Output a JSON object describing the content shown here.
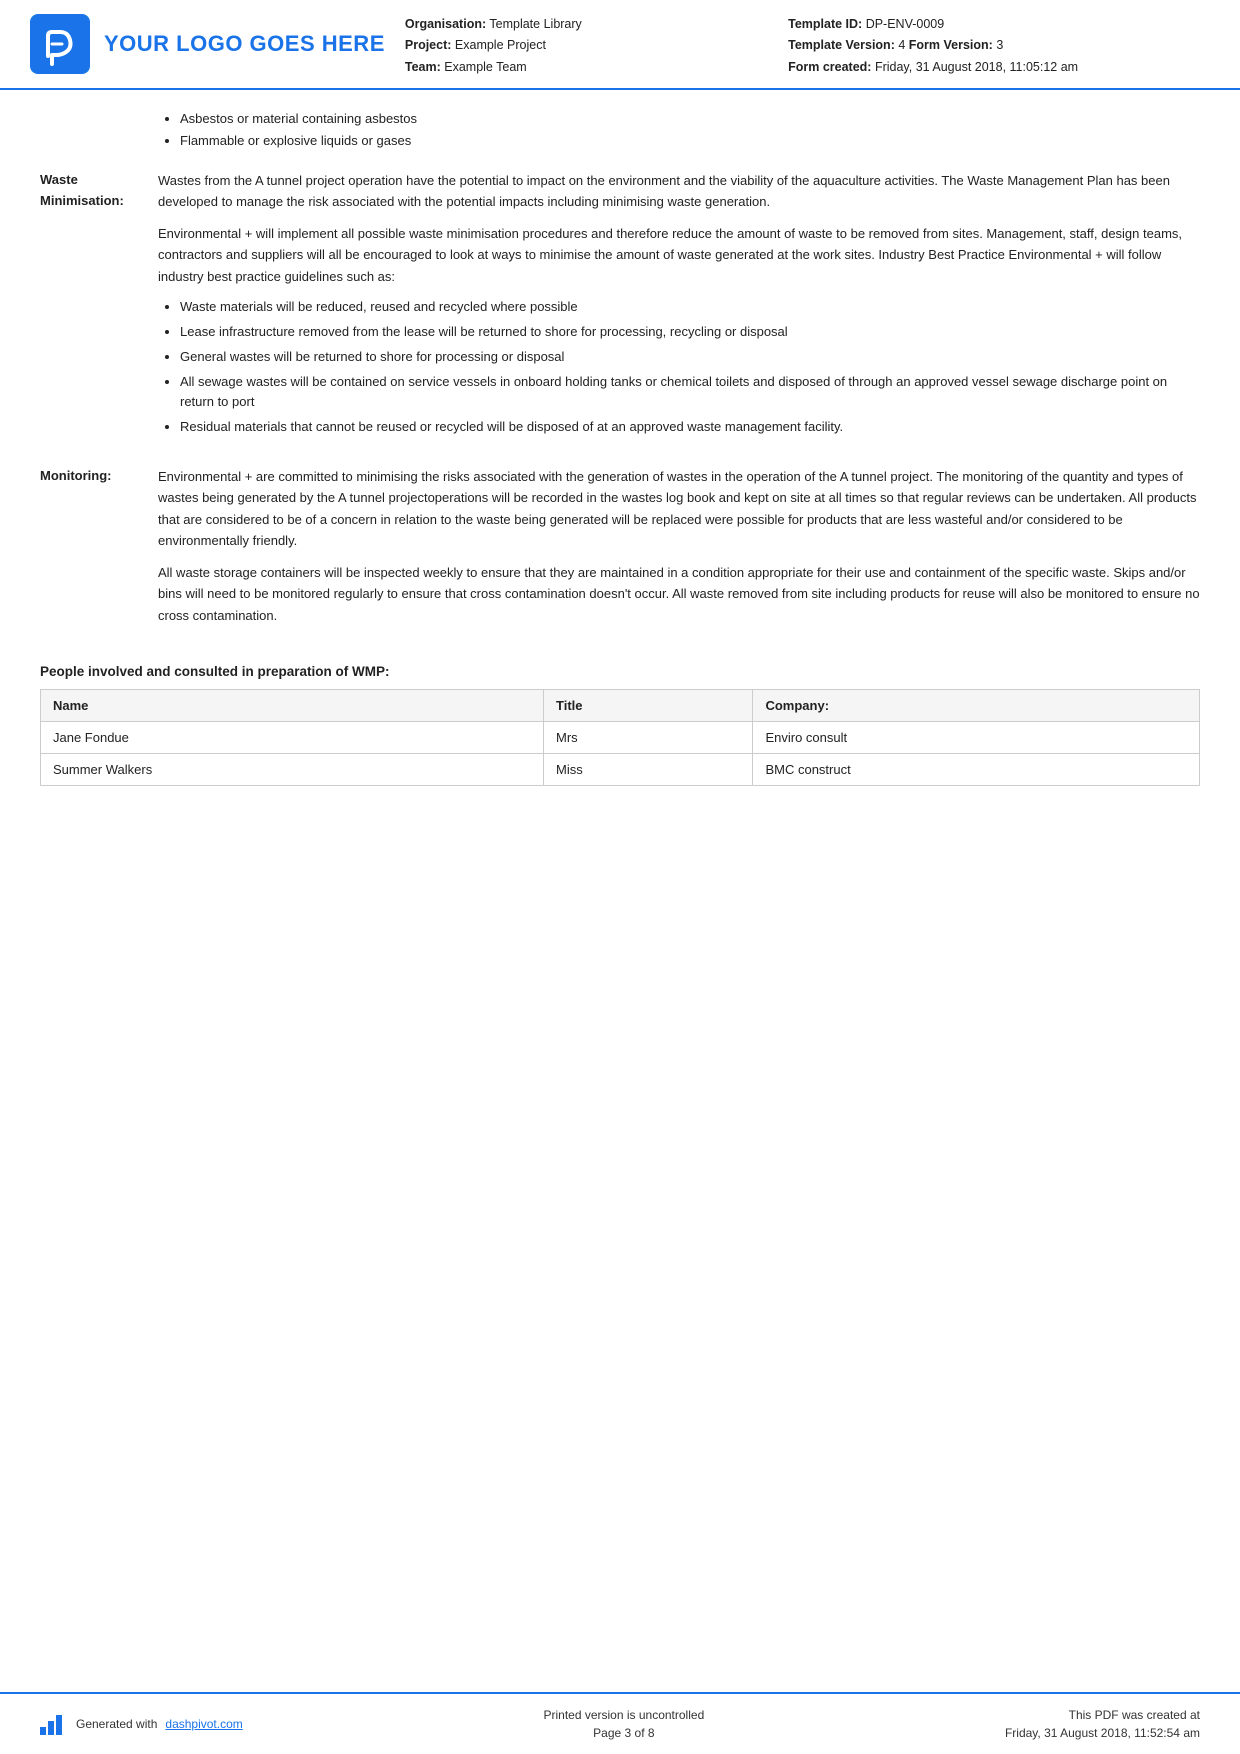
{
  "header": {
    "logo_text": "YOUR LOGO GOES HERE",
    "org_label": "Organisation:",
    "org_value": "Template Library",
    "project_label": "Project:",
    "project_value": "Example Project",
    "team_label": "Team:",
    "team_value": "Example Team",
    "template_id_label": "Template ID:",
    "template_id_value": "DP-ENV-0009",
    "template_version_label": "Template Version:",
    "template_version_value": "4",
    "form_version_label": "Form Version:",
    "form_version_value": "3",
    "form_created_label": "Form created:",
    "form_created_value": "Friday, 31 August 2018, 11:05:12 am"
  },
  "intro_bullets": [
    "Asbestos or material containing asbestos",
    "Flammable or explosive liquids or gases"
  ],
  "sections": [
    {
      "label": "Waste\nMinimisation:",
      "paragraphs": [
        "Wastes from the A tunnel project operation have the potential to impact on the environment and the viability of the aquaculture activities. The Waste Management Plan has been developed to manage the risk associated with the potential impacts including minimising waste generation.",
        "Environmental + will implement all possible waste minimisation procedures and therefore reduce the amount of waste to be removed from sites. Management, staff, design teams, contractors and suppliers will all be encouraged to look at ways to minimise the amount of waste generated at the work sites. Industry Best Practice Environmental + will follow industry best practice guidelines such as:"
      ],
      "bullets": [
        "Waste materials will be reduced, reused and recycled where possible",
        "Lease infrastructure removed from the lease will be returned to shore for processing, recycling or disposal",
        "General wastes will be returned to shore for processing or disposal",
        "All sewage wastes will be contained on service vessels in onboard holding tanks or chemical toilets and disposed of through an approved vessel sewage discharge point on return to port",
        "Residual materials that cannot be reused or recycled will be disposed of at an approved waste management facility."
      ]
    },
    {
      "label": "Monitoring:",
      "paragraphs": [
        "Environmental + are committed to minimising the risks associated with the generation of wastes in the operation of the A tunnel project. The monitoring of the quantity and types of wastes being generated by the A tunnel projectoperations will be recorded in the wastes log book and kept on site at all times so that regular reviews can be undertaken. All products that are considered to be of a concern in relation to the waste being generated will be replaced were possible for products that are less wasteful and/or considered to be environmentally friendly.",
        "All waste storage containers will be inspected weekly to ensure that they are maintained in a condition appropriate for their use and containment of the specific waste. Skips and/or bins will need to be monitored regularly to ensure that cross contamination doesn't occur. All waste removed from site including products for reuse will also be monitored to ensure no cross contamination."
      ],
      "bullets": []
    }
  ],
  "people_section": {
    "title": "People involved and consulted in preparation of WMP:",
    "columns": [
      "Name",
      "Title",
      "Company:"
    ],
    "rows": [
      {
        "name": "Jane Fondue",
        "title": "Mrs",
        "company": "Enviro consult"
      },
      {
        "name": "Summer Walkers",
        "title": "Miss",
        "company": "BMC construct"
      }
    ]
  },
  "footer": {
    "generated_text": "Generated with ",
    "link_text": "dashpivot.com",
    "center_line1": "Printed version is uncontrolled",
    "center_line2": "Page 3 of 8",
    "right_line1": "This PDF was created at",
    "right_line2": "Friday, 31 August 2018, 11:52:54 am"
  }
}
